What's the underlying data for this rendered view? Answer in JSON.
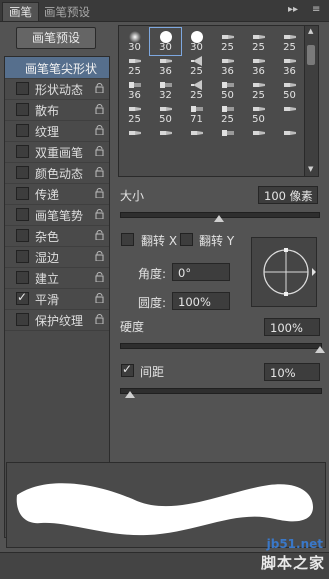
{
  "tabs": [
    {
      "label": "画笔",
      "active": true
    },
    {
      "label": "画笔预设",
      "active": false
    }
  ],
  "panel_controls": {
    "collapse": "▸▸",
    "menu": "≡"
  },
  "preset_button": "画笔预设",
  "options": [
    {
      "label": "画笔笔尖形状",
      "selected": true,
      "has_checkbox": false,
      "checked": false,
      "locked": false
    },
    {
      "label": "形状动态",
      "selected": false,
      "has_checkbox": true,
      "checked": false,
      "locked": true
    },
    {
      "label": "散布",
      "selected": false,
      "has_checkbox": true,
      "checked": false,
      "locked": true
    },
    {
      "label": "纹理",
      "selected": false,
      "has_checkbox": true,
      "checked": false,
      "locked": true
    },
    {
      "label": "双重画笔",
      "selected": false,
      "has_checkbox": true,
      "checked": false,
      "locked": true
    },
    {
      "label": "颜色动态",
      "selected": false,
      "has_checkbox": true,
      "checked": false,
      "locked": true
    },
    {
      "label": "传递",
      "selected": false,
      "has_checkbox": true,
      "checked": false,
      "locked": true
    },
    {
      "label": "画笔笔势",
      "selected": false,
      "has_checkbox": true,
      "checked": false,
      "locked": true
    },
    {
      "label": "杂色",
      "selected": false,
      "has_checkbox": true,
      "checked": false,
      "locked": true
    },
    {
      "label": "湿边",
      "selected": false,
      "has_checkbox": true,
      "checked": false,
      "locked": true
    },
    {
      "label": "建立",
      "selected": false,
      "has_checkbox": true,
      "checked": false,
      "locked": true
    },
    {
      "label": "平滑",
      "selected": false,
      "has_checkbox": true,
      "checked": true,
      "locked": true
    },
    {
      "label": "保护纹理",
      "selected": false,
      "has_checkbox": true,
      "checked": false,
      "locked": true
    }
  ],
  "brush_tips": [
    {
      "size": "30",
      "shape": "soft-round"
    },
    {
      "size": "30",
      "shape": "hard-round",
      "selected": true
    },
    {
      "size": "30",
      "shape": "hard-round"
    },
    {
      "size": "25",
      "shape": "bristle"
    },
    {
      "size": "25",
      "shape": "bristle"
    },
    {
      "size": "25",
      "shape": "bristle"
    },
    {
      "size": "25",
      "shape": "bristle"
    },
    {
      "size": "36",
      "shape": "bristle"
    },
    {
      "size": "25",
      "shape": "fan"
    },
    {
      "size": "36",
      "shape": "bristle"
    },
    {
      "size": "36",
      "shape": "bristle"
    },
    {
      "size": "36",
      "shape": "bristle"
    },
    {
      "size": "36",
      "shape": "flat"
    },
    {
      "size": "32",
      "shape": "flat"
    },
    {
      "size": "25",
      "shape": "fan"
    },
    {
      "size": "50",
      "shape": "flat"
    },
    {
      "size": "25",
      "shape": "bristle"
    },
    {
      "size": "50",
      "shape": "bristle"
    },
    {
      "size": "25",
      "shape": "bristle"
    },
    {
      "size": "50",
      "shape": "bristle"
    },
    {
      "size": "71",
      "shape": "flat"
    },
    {
      "size": "25",
      "shape": "flat"
    },
    {
      "size": "50",
      "shape": "bristle"
    },
    {
      "size": "",
      "shape": "bristle"
    },
    {
      "size": "",
      "shape": "bristle"
    },
    {
      "size": "",
      "shape": "bristle"
    },
    {
      "size": "",
      "shape": "bristle"
    },
    {
      "size": "",
      "shape": "flat"
    },
    {
      "size": "",
      "shape": "bristle"
    },
    {
      "size": "",
      "shape": "bristle"
    }
  ],
  "size": {
    "label": "大小",
    "value": "100 像素",
    "level_fraction": 0.5
  },
  "flip_x": {
    "label": "翻转 X",
    "checked": false
  },
  "flip_y": {
    "label": "翻转 Y",
    "checked": false
  },
  "angle": {
    "label": "角度:",
    "value": "0°"
  },
  "roundness": {
    "label": "圆度:",
    "value": "100%"
  },
  "hardness": {
    "label": "硬度",
    "value": "100%",
    "level_fraction": 1.0
  },
  "spacing": {
    "label": "间距",
    "value": "10%",
    "checked": true,
    "level_fraction": 0.05
  },
  "watermark": {
    "site": "jb51.net",
    "name": "脚本之家"
  },
  "colors": {
    "accent": "#566f8d",
    "panel": "#535353",
    "field": "#3d3d3d"
  }
}
